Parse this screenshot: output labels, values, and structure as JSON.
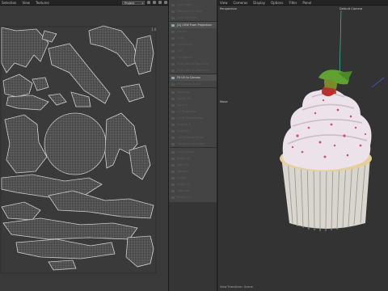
{
  "uv_editor": {
    "menu": [
      "Selection",
      "View",
      "Textures"
    ],
    "dropdown_value": "Project",
    "corner_marker": "1.0"
  },
  "projection_menu": {
    "items": [
      {
        "label": "Sew Edges",
        "active": false
      },
      {
        "label": "Relocate UV Area",
        "active": false
      },
      {
        "label": "Scale UV Area",
        "active": false
      },
      {
        "label": "[A] UVW From Projection",
        "active": true
      },
      {
        "label": "Frontal",
        "active": false
      },
      {
        "label": "Cubic",
        "active": false
      },
      {
        "label": "Cylindrical",
        "active": false
      },
      {
        "label": "Flat",
        "active": false
      },
      {
        "label": "UV Islands",
        "active": false
      },
      {
        "label": "Pack Islands Bounding",
        "active": false
      },
      {
        "label": "Pack Islands Geometry",
        "active": false
      },
      {
        "label": "Fit UV to Canvas",
        "active": true
      },
      {
        "label": "Fit Canvas to UV",
        "active": false
      },
      {
        "label": "Relaxing",
        "active": false
      },
      {
        "label": "Rotate 90",
        "active": false
      },
      {
        "label": "Mirror X",
        "active": false
      },
      {
        "label": "UV Straighten",
        "active": false
      },
      {
        "label": "UV Rectangularize",
        "active": false
      },
      {
        "label": "Align to X",
        "active": false
      },
      {
        "label": "Align to Y",
        "active": false
      },
      {
        "label": "Distribute to Width",
        "active": false
      },
      {
        "label": "Distribute to Height",
        "active": false
      },
      {
        "label": "Grid Layout",
        "active": false
      },
      {
        "label": "Break UV",
        "active": false
      },
      {
        "label": "Weld UV",
        "active": false
      },
      {
        "label": "Equalize",
        "active": false
      },
      {
        "label": "Unfold",
        "active": false
      },
      {
        "label": "Shear UV",
        "active": false
      },
      {
        "label": "Optimize",
        "active": false
      },
      {
        "label": "Reset UV",
        "active": false
      },
      {
        "label": "Terrain",
        "active": false
      }
    ]
  },
  "viewport": {
    "menu": [
      "View",
      "Cameras",
      "Display",
      "Options",
      "Filter",
      "Panel"
    ],
    "label_perspective": "Perspective",
    "label_camera": "Default Camera",
    "label_move": "Move",
    "status": "View Transform: Scene"
  },
  "colors": {
    "accent": "#8ab",
    "active_item": "#505050",
    "uv_bg": "#3a3a3a",
    "viewport_bg": "#333"
  }
}
